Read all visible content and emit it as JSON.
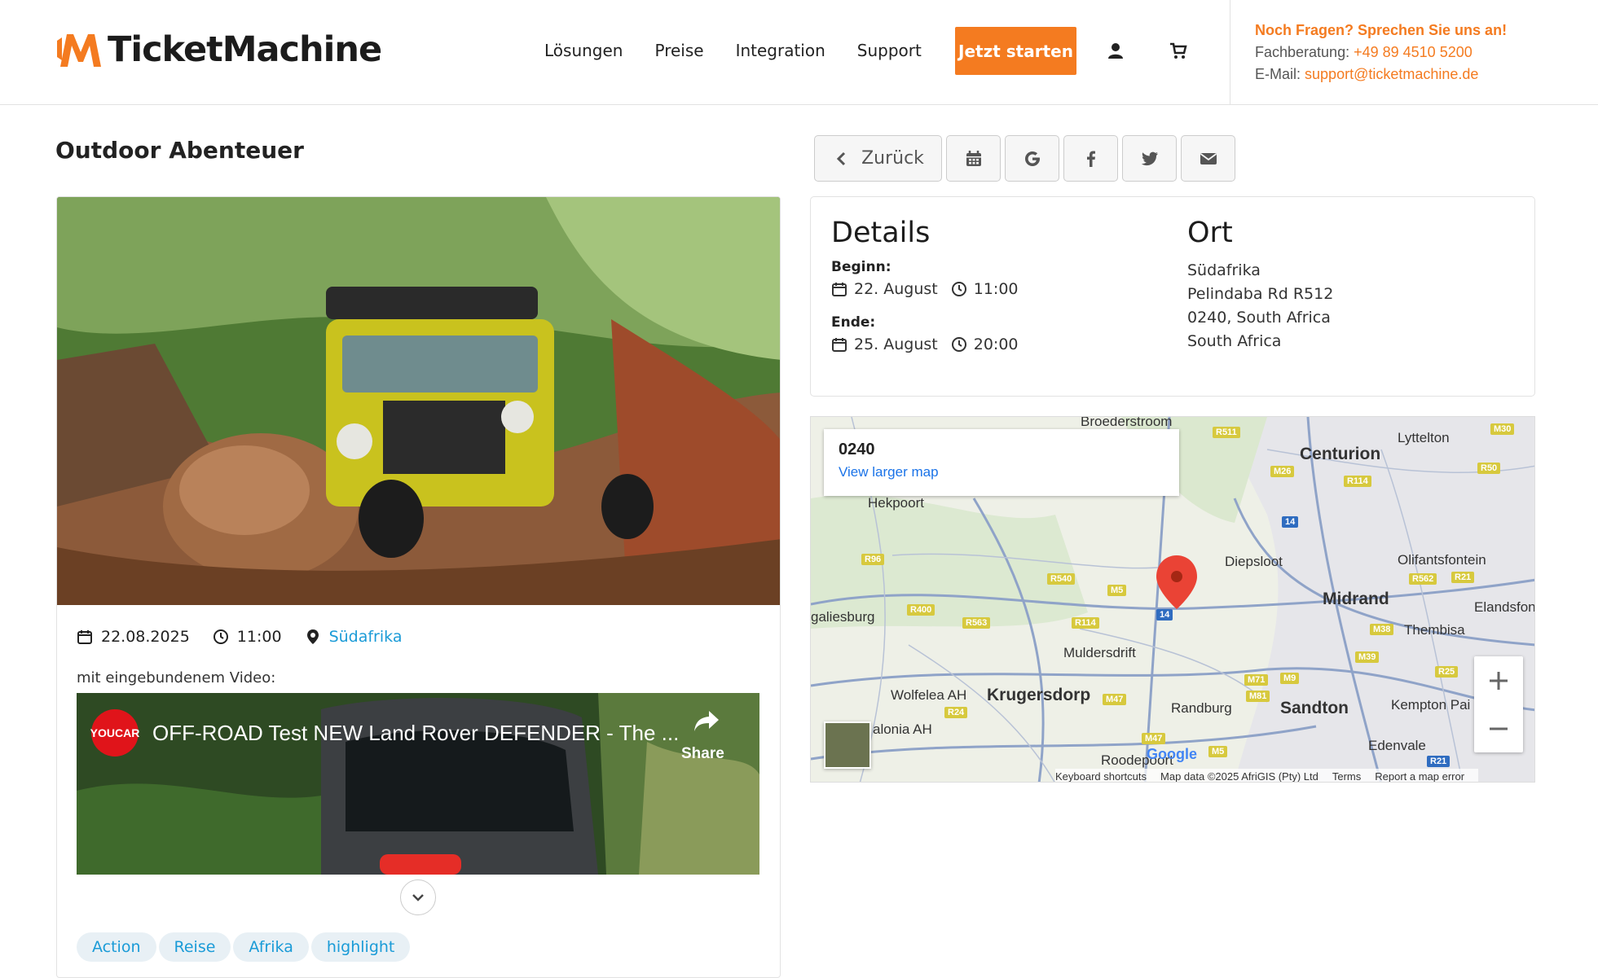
{
  "header": {
    "brand": "TicketMachine",
    "nav": [
      "Lösungen",
      "Preise",
      "Integration",
      "Support"
    ],
    "cta": "Jetzt starten",
    "contact": {
      "question": "Noch Fragen? Sprechen Sie uns an!",
      "phone_label": "Fachberatung:",
      "phone": "+49 89 4510 5200",
      "email_label": "E-Mail:",
      "email": "support@ticketmachine.de"
    }
  },
  "page": {
    "title": "Outdoor Abenteuer"
  },
  "event": {
    "date": "22.08.2025",
    "time": "11:00",
    "location": "Südafrika",
    "video_label": "mit eingebundenem Video:",
    "video": {
      "channel": "YOUCAR",
      "title": "OFF-ROAD Test NEW Land Rover DEFENDER - The ...",
      "share": "Share"
    },
    "tags": [
      "Action",
      "Reise",
      "Afrika",
      "highlight"
    ]
  },
  "toolbar": {
    "back": "Zurück",
    "icons": [
      "calendar-icon",
      "google-icon",
      "facebook-icon",
      "twitter-icon",
      "email-icon"
    ]
  },
  "details": {
    "heading": "Details",
    "begin_label": "Beginn:",
    "begin_date": "22. August",
    "begin_time": "11:00",
    "end_label": "Ende:",
    "end_date": "25. August",
    "end_time": "20:00"
  },
  "place": {
    "heading": "Ort",
    "lines": [
      "Südafrika",
      "Pelindaba Rd R512",
      "0240, South Africa",
      "South Africa"
    ]
  },
  "map": {
    "postal_code": "0240",
    "larger_map": "View larger map",
    "labels": {
      "broederstroom": "Broederstroom",
      "centurion": "Centurion",
      "lyttelton": "Lyttelton",
      "hekpoort": "Hekpoort",
      "diepsloot": "Diepsloot",
      "olifantsfontein": "Olifantsfontein",
      "midrand": "Midrand",
      "elandsfon": "Elandsfon",
      "magaliesburg": "galiesburg",
      "muldersdrift": "Muldersdrift",
      "thembisa": "Thembisa",
      "wolfelea": "Wolfelea AH",
      "krugersdorp": "Krugersdorp",
      "randburg": "Randburg",
      "sandton": "Sandton",
      "kempton": "Kempton Pai",
      "valonia": "alonia AH",
      "edenvale": "Edenvale",
      "roodepoort": "Roodepoort"
    },
    "shields": [
      "R511",
      "M26",
      "R114",
      "M30",
      "R50",
      "14",
      "R96",
      "R540",
      "M5",
      "14",
      "R562",
      "R21",
      "R400",
      "R563",
      "R114",
      "M38",
      "M39",
      "R25",
      "M71",
      "M9",
      "M81",
      "M47",
      "R24",
      "M47",
      "M5",
      "R21"
    ],
    "attribution": {
      "shortcuts": "Keyboard shortcuts",
      "data": "Map data ©2025 AfriGIS (Pty) Ltd",
      "terms": "Terms",
      "report": "Report a map error"
    },
    "google": "Google"
  }
}
